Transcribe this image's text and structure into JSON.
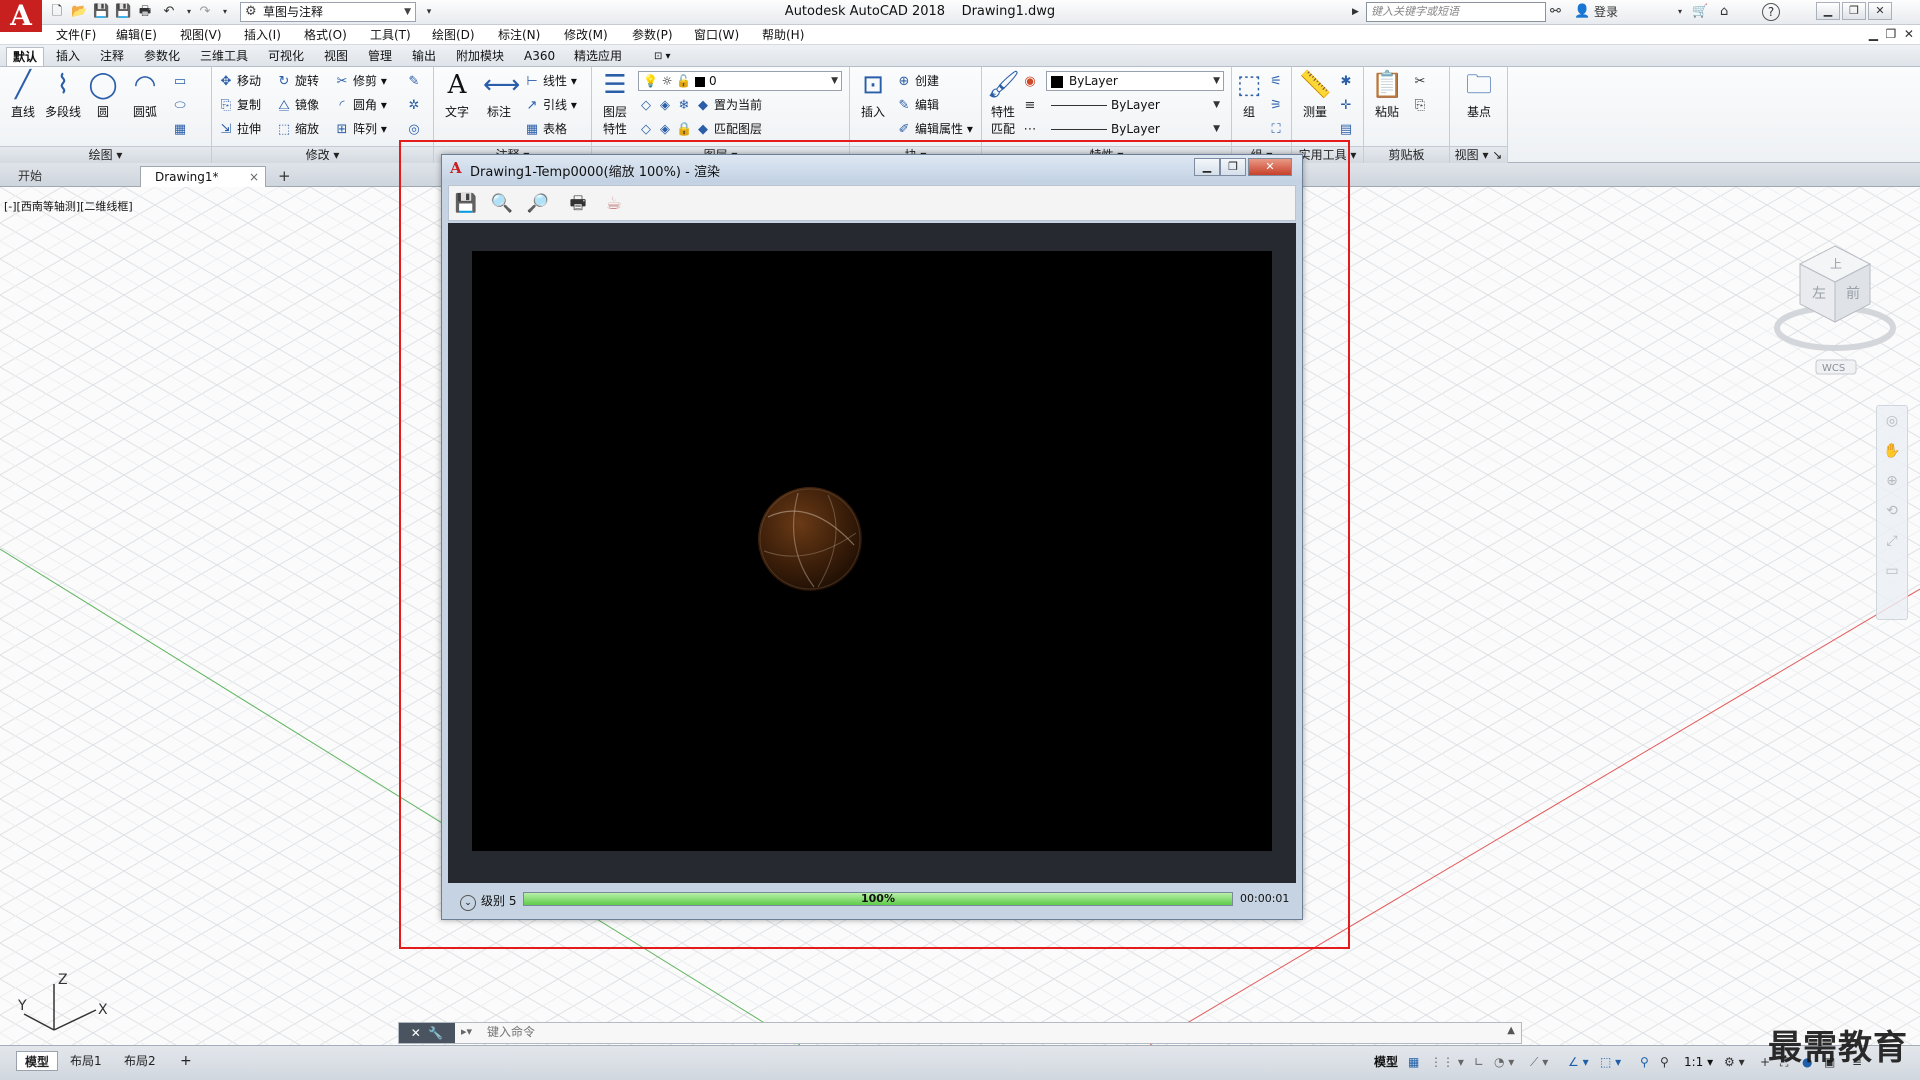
{
  "title_bar": {
    "app_logo": "A",
    "workspace": "草图与注释",
    "app_title": "Autodesk AutoCAD 2018",
    "file_name": "Drawing1.dwg",
    "search_placeholder": "键入关键字或短语",
    "login": "登录",
    "help": "?"
  },
  "menu": [
    "文件(F)",
    "编辑(E)",
    "视图(V)",
    "插入(I)",
    "格式(O)",
    "工具(T)",
    "绘图(D)",
    "标注(N)",
    "修改(M)",
    "参数(P)",
    "窗口(W)",
    "帮助(H)"
  ],
  "ribbon_tabs": [
    "默认",
    "插入",
    "注释",
    "参数化",
    "三维工具",
    "可视化",
    "视图",
    "管理",
    "输出",
    "附加模块",
    "A360",
    "精选应用"
  ],
  "active_ribbon_tab": "默认",
  "ribbon": {
    "draw": {
      "panel": "绘图",
      "line": "直线",
      "polyline": "多段线",
      "circle": "圆",
      "arc": "圆弧"
    },
    "modify": {
      "panel": "修改",
      "move": "移动",
      "rotate": "旋转",
      "trim": "修剪",
      "copy": "复制",
      "mirror": "镜像",
      "fillet": "圆角",
      "stretch": "拉伸",
      "scale": "缩放",
      "array": "阵列"
    },
    "annotation": {
      "panel": "注释",
      "text": "文字",
      "dimension": "标注",
      "linear": "线性",
      "leader": "引线",
      "table": "表格"
    },
    "layers": {
      "panel": "图层",
      "layer_props_1": "图层",
      "layer_props_2": "特性",
      "current_layer": "0",
      "set_current": "置为当前",
      "match_layer": "匹配图层"
    },
    "block": {
      "panel": "块",
      "insert": "插入",
      "create": "创建",
      "edit": "编辑",
      "edit_attr": "编辑属性"
    },
    "properties": {
      "panel": "特性",
      "match_1": "特性",
      "match_2": "匹配",
      "color": "ByLayer",
      "linetype": "ByLayer",
      "lineweight": "ByLayer"
    },
    "groups": {
      "panel": "组",
      "group": "组"
    },
    "utilities": {
      "panel": "实用工具",
      "measure": "测量"
    },
    "clipboard": {
      "panel": "剪贴板",
      "paste": "粘贴"
    },
    "view": {
      "panel": "视图",
      "base": "基点"
    }
  },
  "doc_tabs": [
    "开始",
    "Drawing1*"
  ],
  "active_doc_tab": "Drawing1*",
  "viewport_label": "[-][西南等轴测][二维线框]",
  "view_cube": {
    "top": "上",
    "front": "前",
    "left": "左",
    "wcs": "WCS"
  },
  "render_window": {
    "title": "Drawing1-Temp0000(缩放 100%) - 渲染",
    "level_label": "级别 5",
    "progress": 1.0,
    "progress_text": "100%",
    "elapsed": "00:00:01"
  },
  "command_line": {
    "placeholder": "键入命令"
  },
  "ucs": {
    "x": "X",
    "y": "Y",
    "z": "Z"
  },
  "layout_tabs": [
    "模型",
    "布局1",
    "布局2"
  ],
  "status": {
    "model": "模型",
    "scale": "1:1"
  },
  "watermark": "最需教育",
  "colors": {
    "accent": "#c8201f",
    "highlight": "#e41b1b",
    "progress": "#5ecb4a",
    "render_bg": "#000000"
  }
}
